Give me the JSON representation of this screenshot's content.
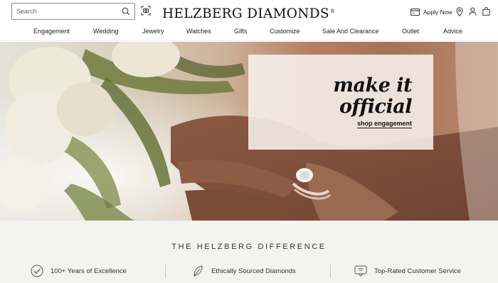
{
  "header": {
    "search": {
      "placeholder": "Search",
      "value": ""
    },
    "brand": "HELZBERG DIAMONDS",
    "brand_mark": "®",
    "apply_now": "Apply Now"
  },
  "nav": {
    "items": [
      "Engagement",
      "Wedding",
      "Jewelry",
      "Watches",
      "Gifts",
      "Customize",
      "Sale And Clearance",
      "Outlet",
      "Advice"
    ]
  },
  "hero": {
    "headline_line1": "make it",
    "headline_line2": "official",
    "cta": "shop engagement"
  },
  "difference": {
    "title": "THE HELZBERG DIFFERENCE",
    "features": [
      {
        "label": "100+ Years of Excellence",
        "icon": "check-badge-icon"
      },
      {
        "label": "Ethically Sourced Diamonds",
        "icon": "leaf-icon"
      },
      {
        "label": "Top-Rated Customer Service",
        "icon": "chat-bubble-icon"
      }
    ]
  },
  "colors": {
    "text": "#222222",
    "band_background": "#f3f3f2",
    "promo_panel": "#f6f1ec"
  }
}
